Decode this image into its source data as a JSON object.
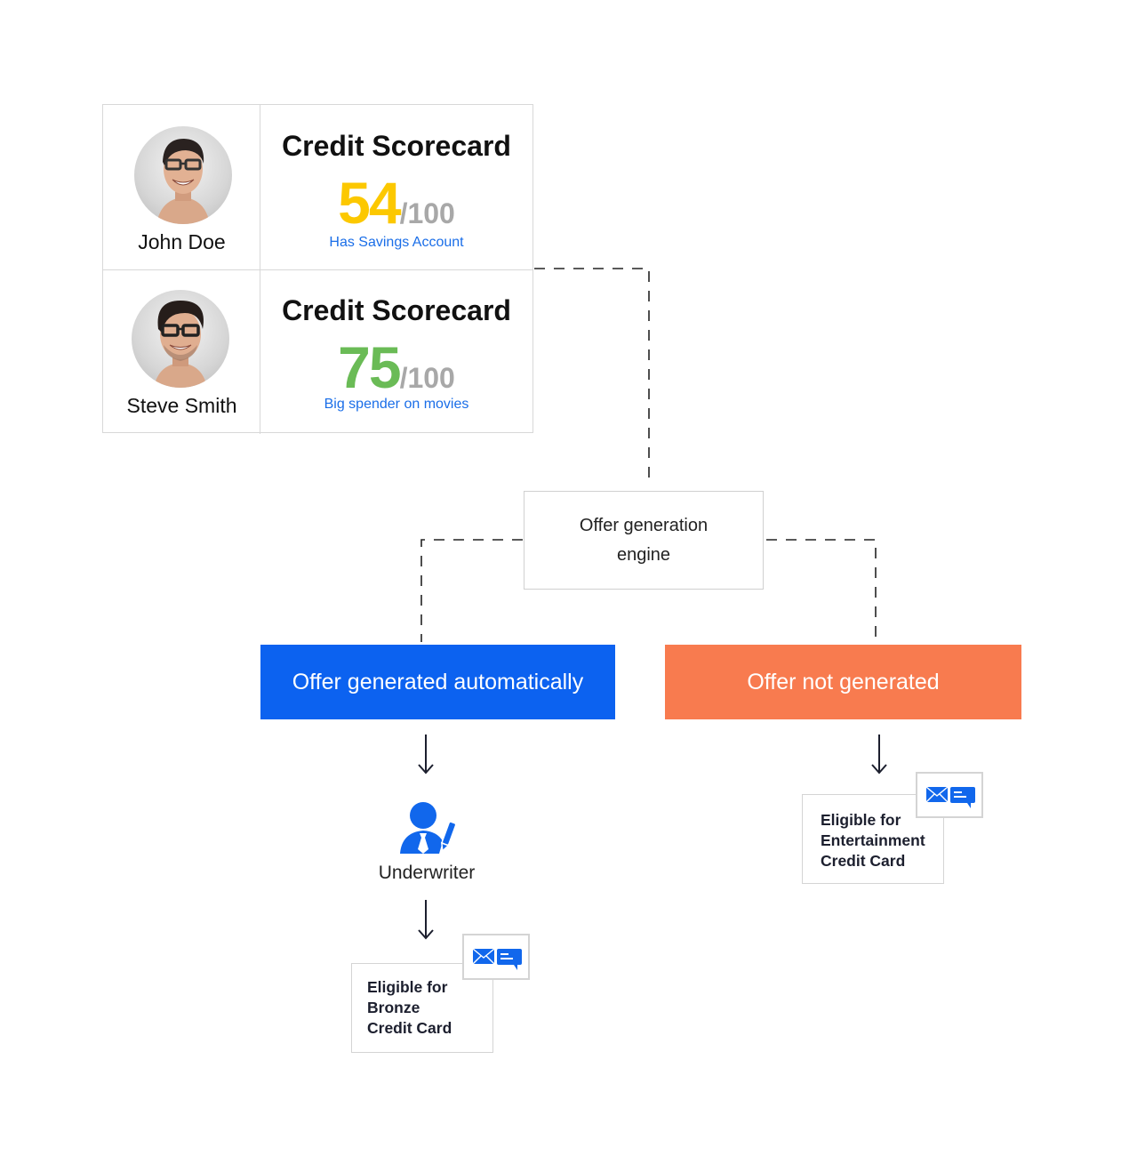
{
  "colors": {
    "score_yellow": "#fcc800",
    "score_green": "#6abb56",
    "denominator_gray": "#a8a8a8",
    "note_blue": "#1a6ee8",
    "offer_auto_blue": "#0c62f0",
    "offer_none_orange": "#f87b4f",
    "icon_blue": "#1167ec"
  },
  "customers": [
    {
      "name": "John Doe",
      "avatar_icon": "person-photo-avatar",
      "scorecard_title": "Credit Scorecard",
      "score": "54",
      "score_max": "/100",
      "score_value": 54,
      "score_color": "yellow",
      "note": "Has Savings Account"
    },
    {
      "name": "Steve Smith",
      "avatar_icon": "person-photo-avatar",
      "scorecard_title": "Credit Scorecard",
      "score": "75",
      "score_max": "/100",
      "score_value": 75,
      "score_color": "green",
      "note": "Big spender on movies"
    }
  ],
  "engine": {
    "label": "Offer generation engine"
  },
  "outcomes": {
    "auto": {
      "label": "Offer generated automatically"
    },
    "none": {
      "label": "Offer not generated"
    }
  },
  "underwriter": {
    "icon": "underwriter-person-pencil-icon",
    "label": "Underwriter"
  },
  "eligibility": {
    "bronze": {
      "lines": [
        "Eligible for",
        "Bronze",
        "Credit Card"
      ],
      "icons": [
        "envelope-icon",
        "chat-bubble-icon"
      ]
    },
    "entertainment": {
      "lines": [
        "Eligible for",
        "Entertainment",
        "Credit Card"
      ],
      "icons": [
        "envelope-icon",
        "chat-bubble-icon"
      ]
    }
  },
  "arrows": {
    "glyph": "down-arrow"
  }
}
